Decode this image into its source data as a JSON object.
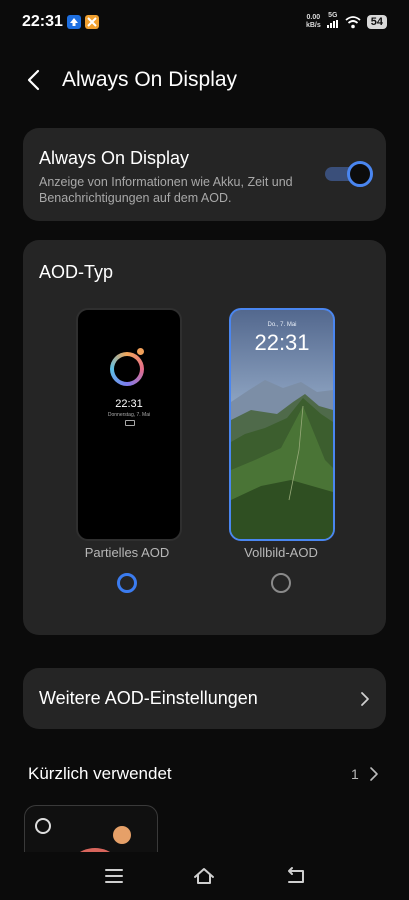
{
  "status_bar": {
    "time": "22:31",
    "net_speed_value": "0.00",
    "net_speed_unit": "kB/s",
    "network": "5G",
    "battery": "54"
  },
  "header": {
    "title": "Always On Display"
  },
  "aod_toggle": {
    "title": "Always On Display",
    "description": "Anzeige von Informationen wie Akku, Zeit und Benachrichtigungen auf dem AOD.",
    "enabled": true
  },
  "aod_type": {
    "title": "AOD-Typ",
    "options": [
      {
        "label": "Partielles AOD",
        "preview_time": "22:31",
        "preview_date": "Donnerstag, 7. Mai",
        "selected": true
      },
      {
        "label": "Vollbild-AOD",
        "preview_time": "22:31",
        "preview_date": "Do., 7. Mai",
        "selected": false
      }
    ]
  },
  "more_settings": {
    "label": "Weitere AOD-Einstellungen"
  },
  "recent": {
    "title": "Kürzlich verwendet",
    "count": "1"
  },
  "colors": {
    "accent": "#3b7cf0",
    "card": "#252525",
    "background": "#0b0b0b"
  }
}
